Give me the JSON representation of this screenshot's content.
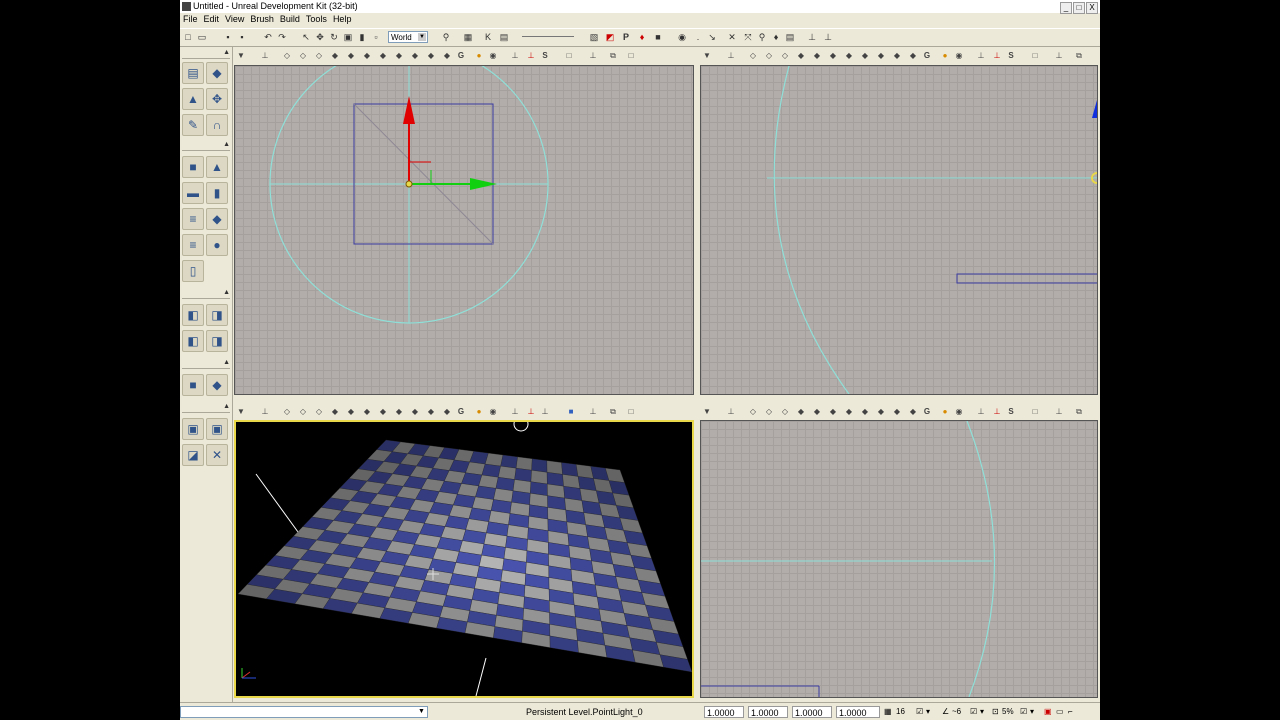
{
  "window": {
    "title": "Untitled - Unreal Development Kit (32-bit)",
    "controls": [
      "_",
      "□",
      "X"
    ]
  },
  "menu": [
    "File",
    "Edit",
    "View",
    "Brush",
    "Build",
    "Tools",
    "Help"
  ],
  "toolbar": {
    "coordinate_system": "World",
    "play_label": "P"
  },
  "viewport_toolbar": {
    "grid_label": "G",
    "scale_label": "S"
  },
  "statusbar": {
    "combo_value": "",
    "level_label": "Persistent Level.PointLight_0",
    "drag_grid": [
      "1.0000",
      "1.0000",
      "1.0000",
      "1.0000"
    ],
    "grid_size": "16",
    "rotation_snap": "~6",
    "scale_snap": "5%"
  },
  "colors": {
    "app_bg": "#ece9d8",
    "ortho_grid": "#b2acaa",
    "brush_wire": "#8fe0d8",
    "selection_box": "#3a3aa0",
    "active_viewport": "#e8d84a",
    "checker_blue": "#4b56b4",
    "checker_gray": "#b6b6b6"
  }
}
